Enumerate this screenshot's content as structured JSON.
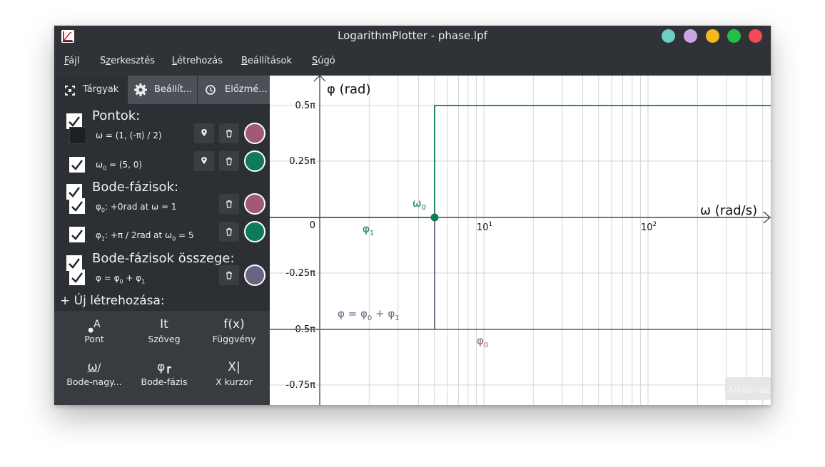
{
  "window": {
    "title": "LogarithmPlotter - phase.lpf"
  },
  "window_buttons": [
    {
      "name": "teal",
      "color": "#6ccfc1"
    },
    {
      "name": "lavender",
      "color": "#c9a6df"
    },
    {
      "name": "yellow",
      "color": "#f5b91b"
    },
    {
      "name": "green",
      "color": "#22c146"
    },
    {
      "name": "red",
      "color": "#f24b55"
    }
  ],
  "menu": {
    "file": {
      "u": "F",
      "rest": "ájl"
    },
    "edit": {
      "pre": "S",
      "u": "z",
      "rest": "erkesztés"
    },
    "create": {
      "u": "L",
      "rest": "étrehozás"
    },
    "settings": {
      "u": "B",
      "rest": "eállítások"
    },
    "help": {
      "u": "S",
      "rest": "úgó"
    }
  },
  "tabs": {
    "objects": "Tárgyak",
    "settings": "Beállít...",
    "history": "Előzmé..."
  },
  "sections": {
    "points": "Pontok:",
    "bode_phase": "Bode-fázisok:",
    "bode_phase_sum": "Bode-fázisok összege:"
  },
  "objects": {
    "omega": {
      "label": "ω = (1, (-π) / 2)",
      "color": "#a05978"
    },
    "omega0": {
      "label_pre": "ω",
      "label_sub": "0",
      "label_post": " = (5, 0)",
      "color": "#0d7b58"
    },
    "phi0": {
      "pre": "φ",
      "sub": "0",
      "post": ": +0rad at ω = 1",
      "color": "#a05978"
    },
    "phi1": {
      "pre": "φ",
      "sub": "1",
      "mid": ": +π / 2rad at ω",
      "sub2": "0",
      "post": " = 5",
      "color": "#0d7b58"
    },
    "phi": {
      "pre": "φ = φ",
      "sub": "0",
      "mid": " + φ",
      "sub2": "1",
      "color": "#6b6480"
    }
  },
  "create": {
    "title": "+ Új létrehozása:",
    "tools": [
      {
        "id": "point",
        "label": "Pont",
        "icon_text": "A"
      },
      {
        "id": "text",
        "label": "Szöveg",
        "icon_text": "It"
      },
      {
        "id": "function",
        "label": "Függvény",
        "icon_text": "f(x)"
      },
      {
        "id": "bode-magnitude",
        "label": "Bode-nagy...",
        "icon_text": "ω"
      },
      {
        "id": "bode-phase",
        "label": "Bode-fázis",
        "icon_text": "φ"
      },
      {
        "id": "x-cursor",
        "label": "X kurzor",
        "icon_text": "X"
      }
    ]
  },
  "graph": {
    "y_axis_label": "φ (rad)",
    "x_axis_label": "ω (rad/s)",
    "y_ticks": [
      "0.5π",
      "0.25π",
      "0",
      "-0.25π",
      "-0.5π",
      "-0.75π"
    ],
    "x_ticks": [
      {
        "base": "10",
        "exp": "1"
      },
      {
        "base": "10",
        "exp": "2"
      }
    ],
    "labels": {
      "omega0": {
        "base": "ω",
        "sub": "0"
      },
      "phi1": {
        "base": "φ",
        "sub": "1"
      },
      "phi0": {
        "base": "φ",
        "sub": "0"
      },
      "phi_sum": {
        "base": "φ = φ",
        "sub": "0",
        "mid": " + φ",
        "sub2": "1"
      }
    },
    "colors": {
      "green": "#0d7b58",
      "pink": "#a05978",
      "slate": "#6b6480",
      "grid": "#d6d6d6"
    },
    "faded_button": "Alkalmaz"
  }
}
